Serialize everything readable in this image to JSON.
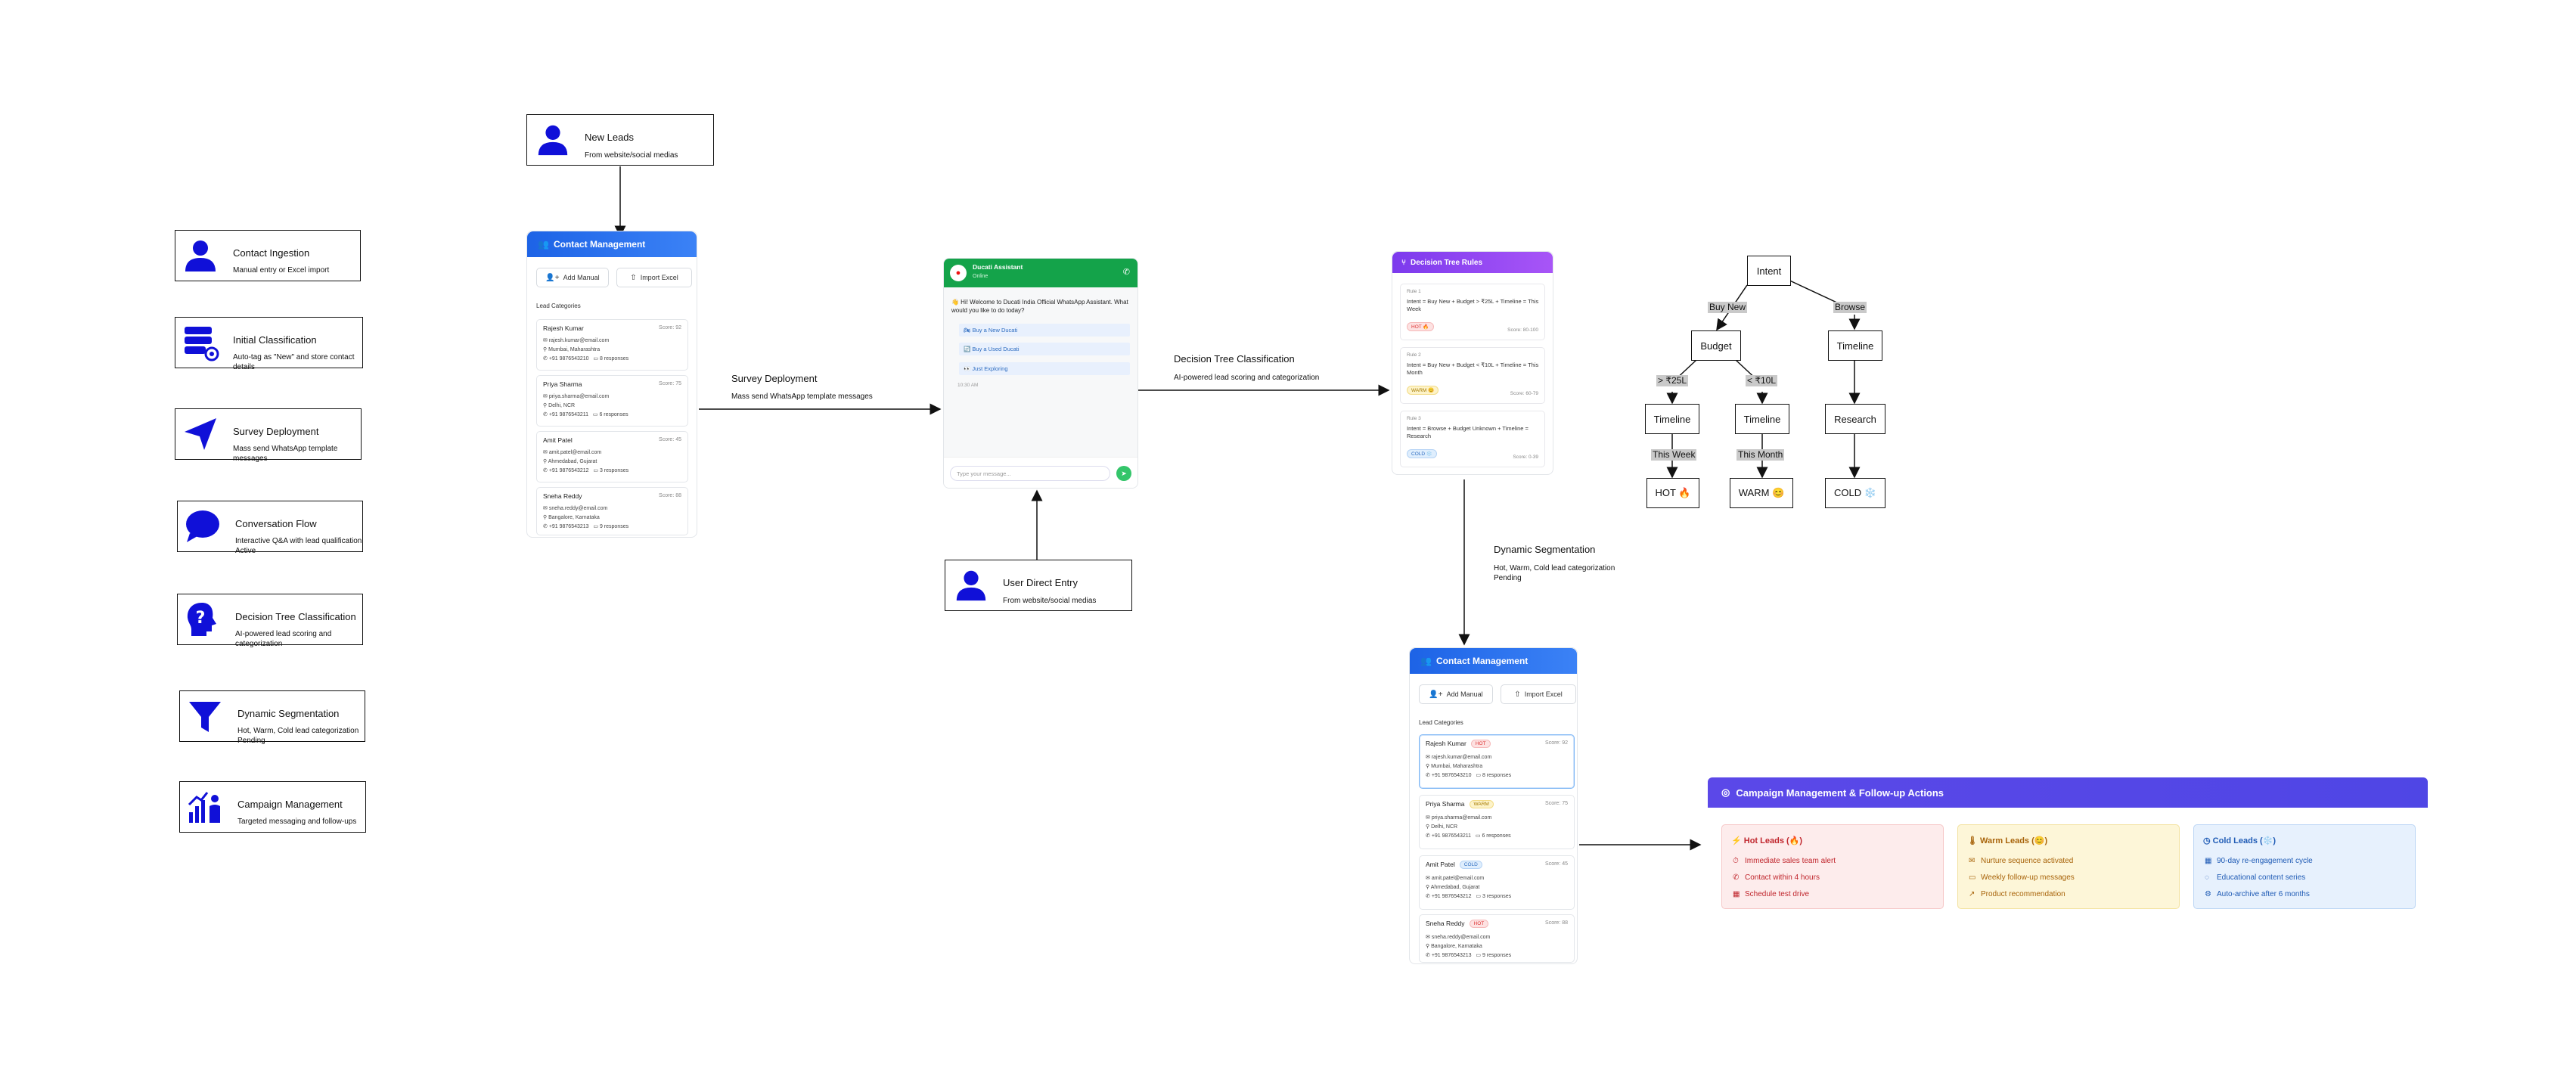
{
  "legend": [
    {
      "icon": "person-icon",
      "title": "Contact Ingestion",
      "desc": "Manual entry or Excel import"
    },
    {
      "icon": "database-gear-icon",
      "title": "Initial Classification",
      "desc": "Auto-tag as \"New\" and store contact details"
    },
    {
      "icon": "paper-plane-icon",
      "title": "Survey Deployment",
      "desc": "Mass send WhatsApp template messages"
    },
    {
      "icon": "speech-bubble-icon",
      "title": "Conversation Flow",
      "desc": "Interactive Q&A with lead qualification Active"
    },
    {
      "icon": "question-head-icon",
      "title": "Decision Tree Classification",
      "desc": "AI-powered lead scoring and categorization"
    },
    {
      "icon": "funnel-icon",
      "title": "Dynamic Segmentation",
      "desc": "Hot, Warm, Cold lead categorization Pending"
    },
    {
      "icon": "chart-person-icon",
      "title": "Campaign Management",
      "desc": "Targeted messaging and follow-ups"
    }
  ],
  "new_leads": {
    "title": "New Leads",
    "subtitle": "From website/social medias"
  },
  "user_direct": {
    "title": "User Direct Entry",
    "subtitle": "From website/social medias"
  },
  "contact_panel": {
    "title": "Contact Management",
    "add_manual": "Add Manual",
    "import_excel": "Import Excel",
    "lead_categories": "Lead Categories"
  },
  "contacts_top": [
    {
      "name": "Rajesh Kumar",
      "score": "Score: 92",
      "email": "rajesh.kumar@email.com",
      "city": "Mumbai, Maharashtra",
      "phone": "+91 9876543210",
      "responses": "8 responses"
    },
    {
      "name": "Priya Sharma",
      "score": "Score: 75",
      "email": "priya.sharma@email.com",
      "city": "Delhi, NCR",
      "phone": "+91 9876543211",
      "responses": "6 responses"
    },
    {
      "name": "Amit Patel",
      "score": "Score: 45",
      "email": "amit.patel@email.com",
      "city": "Ahmedabad, Gujarat",
      "phone": "+91 9876543212",
      "responses": "3 responses"
    },
    {
      "name": "Sneha Reddy",
      "score": "Score: 88",
      "email": "sneha.reddy@email.com",
      "city": "Bangalore, Karnataka",
      "phone": "+91 9876543213",
      "responses": "9 responses"
    }
  ],
  "contacts_bottom": [
    {
      "name": "Rajesh Kumar",
      "badge": "HOT",
      "badge_type": "hot",
      "score": "Score: 92",
      "email": "rajesh.kumar@email.com",
      "city": "Mumbai, Maharashtra",
      "phone": "+91 9876543210",
      "responses": "8 responses"
    },
    {
      "name": "Priya Sharma",
      "badge": "WARM",
      "badge_type": "warm",
      "score": "Score: 75",
      "email": "priya.sharma@email.com",
      "city": "Delhi, NCR",
      "phone": "+91 9876543211",
      "responses": "6 responses"
    },
    {
      "name": "Amit Patel",
      "badge": "COLD",
      "badge_type": "cold",
      "score": "Score: 45",
      "email": "amit.patel@email.com",
      "city": "Ahmedabad, Gujarat",
      "phone": "+91 9876543212",
      "responses": "3 responses"
    },
    {
      "name": "Sneha Reddy",
      "badge": "HOT",
      "badge_type": "hot",
      "score": "Score: 88",
      "email": "sneha.reddy@email.com",
      "city": "Bangalore, Karnataka",
      "phone": "+91 9876543213",
      "responses": "9 responses"
    }
  ],
  "chat": {
    "name": "Ducati Assistant",
    "status": "Online",
    "message": "👋 Hi! Welcome to Ducati India Official WhatsApp Assistant. What would you like to do today?",
    "options": [
      "🏍 Buy a New Ducati",
      "🔄 Buy a Used Ducati",
      "👀 Just Exploring"
    ],
    "time": "10:30 AM",
    "placeholder": "Type your message..."
  },
  "edges": {
    "survey": {
      "title": "Survey Deployment",
      "sub": "Mass send WhatsApp template messages"
    },
    "decision": {
      "title": "Decision Tree Classification",
      "sub": "AI-powered lead scoring and categorization"
    },
    "dynamic": {
      "title": "Dynamic Segmentation",
      "sub": "Hot, Warm, Cold lead categorization Pending"
    }
  },
  "rules": {
    "title": "Decision Tree Rules",
    "items": [
      {
        "num": "Rule 1",
        "text": "Intent = Buy New + Budget > ₹25L + Timeline = This Week",
        "badge": "HOT 🔥",
        "badge_type": "hot",
        "score": "Score: 80-100"
      },
      {
        "num": "Rule 2",
        "text": "Intent = Buy New + Budget < ₹10L + Timeline = This Month",
        "badge": "WARM 😊",
        "badge_type": "warm",
        "score": "Score: 60-79"
      },
      {
        "num": "Rule 3",
        "text": "Intent = Browse + Budget Unknown + Timeline = Research",
        "badge": "COLD ❄️",
        "badge_type": "cold",
        "score": "Score: 0-39"
      }
    ]
  },
  "tree": {
    "intent": "Intent",
    "buy_new": "Buy New",
    "browse": "Browse",
    "budget": "Budget",
    "timeline_r": "Timeline",
    "gt25": "> ₹25L",
    "lt10": "< ₹10L",
    "timeline_a": "Timeline",
    "timeline_b": "Timeline",
    "research": "Research",
    "this_week": "This Week",
    "this_month": "This Month",
    "hot": "HOT 🔥",
    "warm": "WARM 😊",
    "cold": "COLD ❄️"
  },
  "campaign": {
    "title": "Campaign Management & Follow-up Actions",
    "columns": [
      {
        "title": "Hot Leads (🔥)",
        "type": "hot",
        "items": [
          {
            "icon": "⏱",
            "text": "Immediate sales team alert"
          },
          {
            "icon": "📞",
            "text": "Contact within 4 hours"
          },
          {
            "icon": "📅",
            "text": "Schedule test drive"
          }
        ]
      },
      {
        "title": "Warm Leads (😊)",
        "type": "warm",
        "items": [
          {
            "icon": "✉",
            "text": "Nurture sequence activated"
          },
          {
            "icon": "💬",
            "text": "Weekly follow-up messages"
          },
          {
            "icon": "↗",
            "text": "Product recommendation"
          }
        ]
      },
      {
        "title": "Cold Leads (❄️)",
        "type": "cold",
        "items": [
          {
            "icon": "📅",
            "text": "90-day re-engagement cycle"
          },
          {
            "icon": "💭",
            "text": "Educational content series"
          },
          {
            "icon": "⚙",
            "text": "Auto-archive after 6 months"
          }
        ]
      }
    ]
  }
}
